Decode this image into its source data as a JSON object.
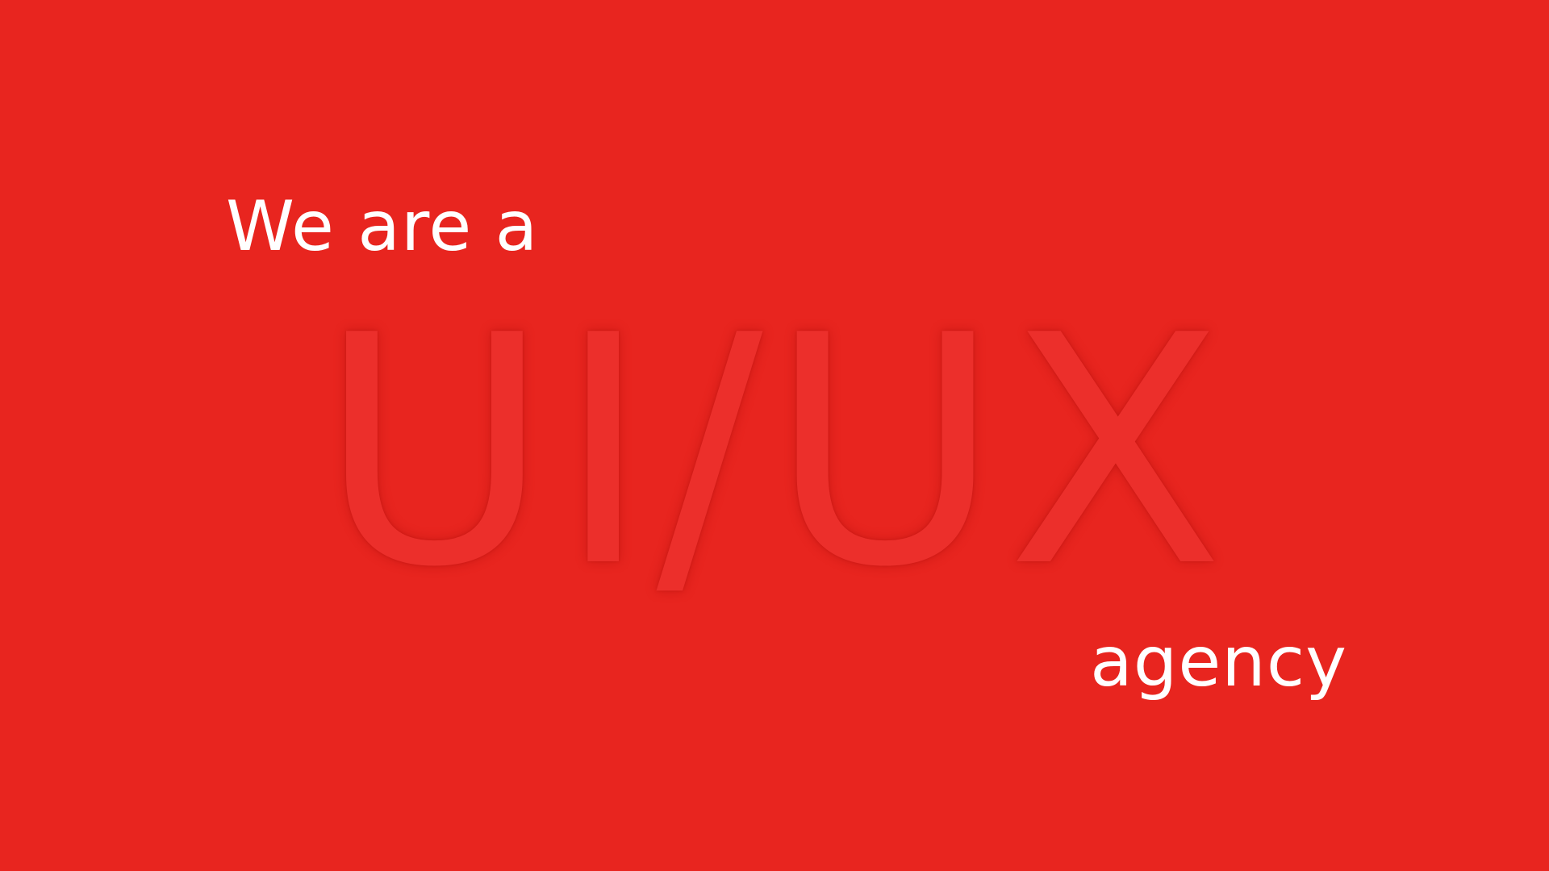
{
  "slide": {
    "intro_text": "We are a",
    "headline": "UI/UX",
    "outro_text": "agency"
  },
  "colors": {
    "background": "#e8251f",
    "text": "#ffffff",
    "headline": "#ec2f2b"
  }
}
